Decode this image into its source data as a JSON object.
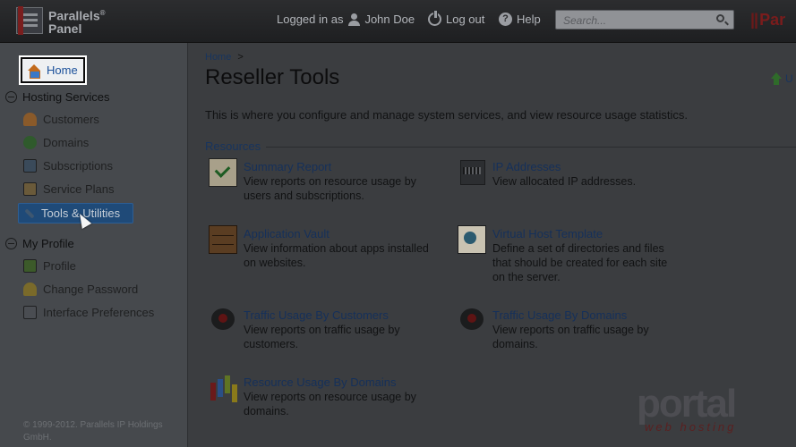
{
  "header": {
    "brand_line1": "Parallels",
    "brand_sup": "®",
    "brand_line2": "Panel",
    "logged_in_label": "Logged in as",
    "user_name": "John Doe",
    "logout_label": "Log out",
    "help_label": "Help",
    "search_placeholder": "Search...",
    "right_logo": "Par"
  },
  "sidebar": {
    "home_label": "Home",
    "sections": [
      {
        "title": "Hosting Services",
        "items": [
          {
            "label": "Customers",
            "icon": "customers-icon"
          },
          {
            "label": "Domains",
            "icon": "domains-icon"
          },
          {
            "label": "Subscriptions",
            "icon": "subscriptions-icon"
          },
          {
            "label": "Service Plans",
            "icon": "service-plans-icon"
          },
          {
            "label": "Tools & Utilities",
            "icon": "tools-icon",
            "active": true
          }
        ]
      },
      {
        "title": "My Profile",
        "items": [
          {
            "label": "Profile",
            "icon": "profile-icon"
          },
          {
            "label": "Change Password",
            "icon": "key-icon"
          },
          {
            "label": "Interface Preferences",
            "icon": "preferences-icon"
          }
        ]
      }
    ],
    "copyright": "© 1999-2012. Parallels IP Holdings GmbH."
  },
  "main": {
    "breadcrumb_home": "Home",
    "breadcrumb_sep": ">",
    "title": "Reseller Tools",
    "up_label": "U",
    "intro": "This is where you configure and manage system services, and view resource usage statistics.",
    "resources_label": "Resources",
    "tools": [
      {
        "title": "Summary Report",
        "desc": "View reports on resource usage by users and subscriptions."
      },
      {
        "title": "IP Addresses",
        "desc": "View allocated IP addresses."
      },
      {
        "title": "Application Vault",
        "desc": "View information about apps installed on websites."
      },
      {
        "title": "Virtual Host Template",
        "desc": "Define a set of directories and files that should be created for each site on the server."
      },
      {
        "title": "Traffic Usage By Customers",
        "desc": "View reports on traffic usage by customers."
      },
      {
        "title": "Traffic Usage By Domains",
        "desc": "View reports on traffic usage by domains."
      },
      {
        "title": "Resource Usage By Domains",
        "desc": "View reports on resource usage by domains."
      }
    ]
  },
  "watermark": {
    "main": "portal",
    "sub": "web hosting"
  }
}
